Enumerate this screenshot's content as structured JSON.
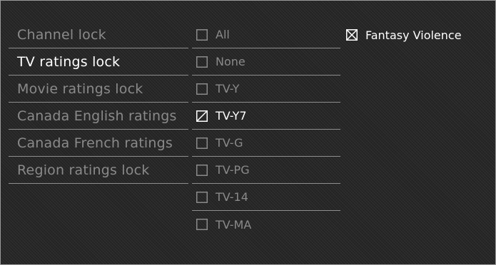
{
  "menu": {
    "items": [
      {
        "label": "Channel lock"
      },
      {
        "label": "TV ratings lock"
      },
      {
        "label": "Movie ratings lock"
      },
      {
        "label": "Canada English ratings"
      },
      {
        "label": "Canada French ratings"
      },
      {
        "label": "Region ratings lock"
      }
    ],
    "selected_label": "TV ratings lock"
  },
  "ratings": {
    "items": [
      {
        "label": "All",
        "state": "unchecked"
      },
      {
        "label": "None",
        "state": "unchecked"
      },
      {
        "label": "TV-Y",
        "state": "unchecked"
      },
      {
        "label": "TV-Y7",
        "state": "partial"
      },
      {
        "label": "TV-G",
        "state": "unchecked"
      },
      {
        "label": "TV-PG",
        "state": "unchecked"
      },
      {
        "label": "TV-14",
        "state": "unchecked"
      },
      {
        "label": "TV-MA",
        "state": "unchecked"
      }
    ],
    "focused_label": "TV-Y7"
  },
  "content": {
    "items": [
      {
        "label": "Fantasy Violence",
        "state": "checked"
      }
    ]
  },
  "colors": {
    "background": "#262626",
    "text_active": "#ffffff",
    "text_inactive": "#8a8a8a",
    "divider": "#8e8e8e"
  },
  "icons": {
    "unchecked": "checkbox-empty-icon",
    "partial": "checkbox-slash-icon",
    "checked": "checkbox-cross-icon"
  }
}
